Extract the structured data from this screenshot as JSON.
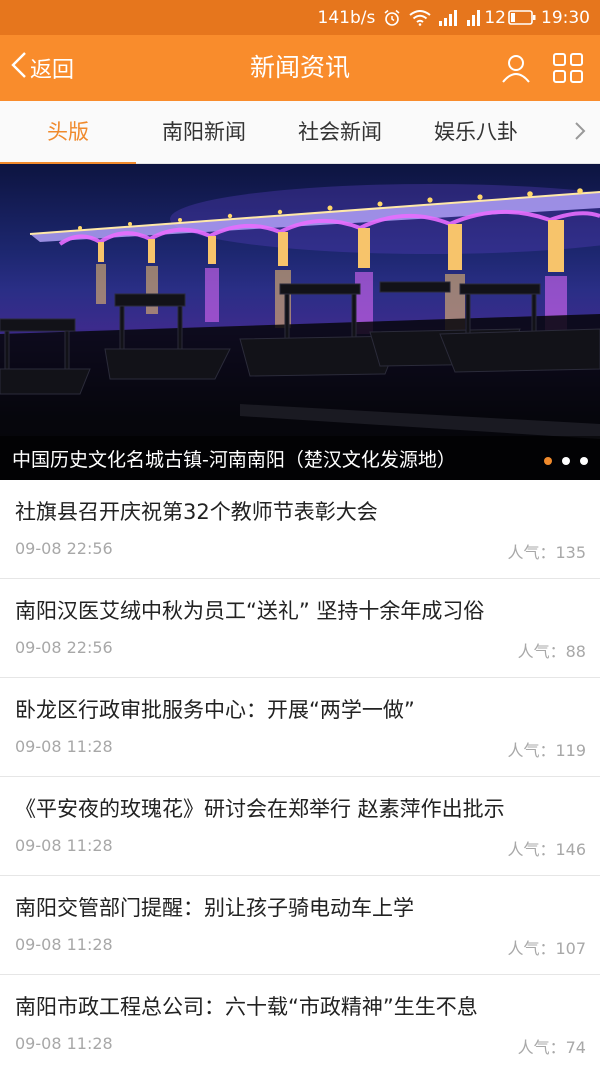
{
  "status_bar": {
    "net_speed": "141b/s",
    "battery": "12",
    "time": "19:30",
    "alarm_icon": "alarm-icon",
    "wifi_icon": "wifi-icon",
    "signal_icon": "signal-icon",
    "battery_icon": "battery-icon"
  },
  "header": {
    "back_label": "返回",
    "title": "新闻资讯",
    "back_icon": "chevron-left-icon",
    "user_icon": "user-icon",
    "grid_icon": "grid-icon",
    "color": "#f98c2c"
  },
  "tabs": [
    {
      "label": "头版",
      "active": true
    },
    {
      "label": "南阳新闻",
      "active": false
    },
    {
      "label": "社会新闻",
      "active": false
    },
    {
      "label": "娱乐八卦",
      "active": false
    }
  ],
  "tabs_more_icon": "chevron-right-icon",
  "banner": {
    "caption": "中国历史文化名城古镇-河南南阳（楚汉文化发源地）",
    "dots": [
      true,
      false,
      false
    ]
  },
  "news": [
    {
      "title": "社旗县召开庆祝第32个教师节表彰大会",
      "time": "09-08 22:56",
      "popularity": "人气：135"
    },
    {
      "title": "南阳汉医艾绒中秋为员工“送礼” 坚持十余年成习俗",
      "time": "09-08 22:56",
      "popularity": "人气：88"
    },
    {
      "title": "卧龙区行政审批服务中心：开展“两学一做”",
      "time": "09-08 11:28",
      "popularity": "人气：119"
    },
    {
      "title": "《平安夜的玫瑰花》研讨会在郑举行 赵素萍作出批示",
      "time": "09-08 11:28",
      "popularity": "人气：146"
    },
    {
      "title": "南阳交管部门提醒：别让孩子骑电动车上学",
      "time": "09-08 11:28",
      "popularity": "人气：107"
    },
    {
      "title": "南阳市政工程总公司：六十载“市政精神”生生不息",
      "time": "09-08 11:28",
      "popularity": "人气：74"
    }
  ],
  "accent_color": "#f08a2c"
}
